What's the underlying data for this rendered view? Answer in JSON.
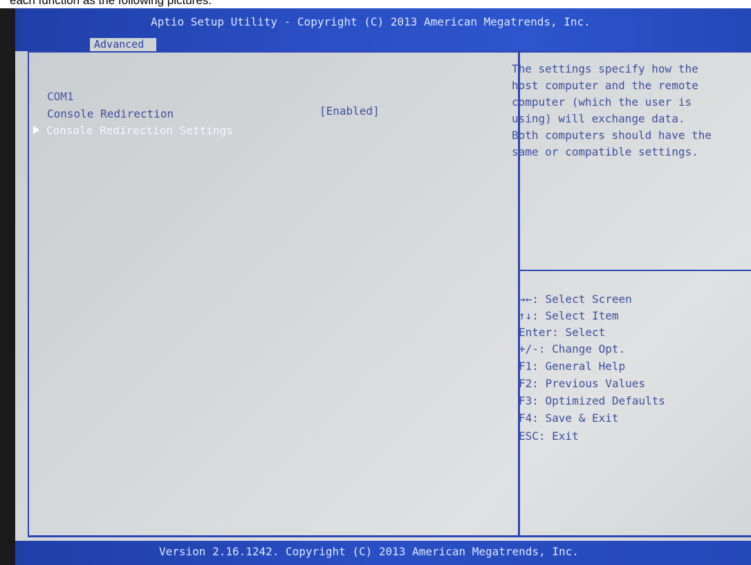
{
  "caption": "each function as the following pictures.",
  "header": {
    "title": "Aptio Setup Utility - Copyright (C) 2013 American Megatrends, Inc.",
    "active_tab": "Advanced"
  },
  "main": {
    "section_heading": "COM1",
    "settings": [
      {
        "label": "Console Redirection",
        "value": "[Enabled]"
      }
    ],
    "submenu": {
      "label": "Console Redirection Settings"
    }
  },
  "help": {
    "lines": [
      "The settings specify how the",
      "host computer and the remote",
      "computer (which the user is",
      "using) will exchange data.",
      "Both computers should have the",
      "same or compatible settings."
    ]
  },
  "keys": [
    "→←: Select Screen",
    "↑↓: Select Item",
    "Enter: Select",
    "+/-: Change Opt.",
    "F1: General Help",
    "F2: Previous Values",
    "F3: Optimized Defaults",
    "F4: Save & Exit",
    "ESC: Exit"
  ],
  "footer": {
    "text": "Version 2.16.1242. Copyright (C) 2013 American Megatrends, Inc."
  },
  "colors": {
    "accent_blue": "#2a46b4",
    "screen_gray": "#d4d7d9",
    "text_blue": "#3f4f9e",
    "highlight_white": "#ffffff"
  }
}
